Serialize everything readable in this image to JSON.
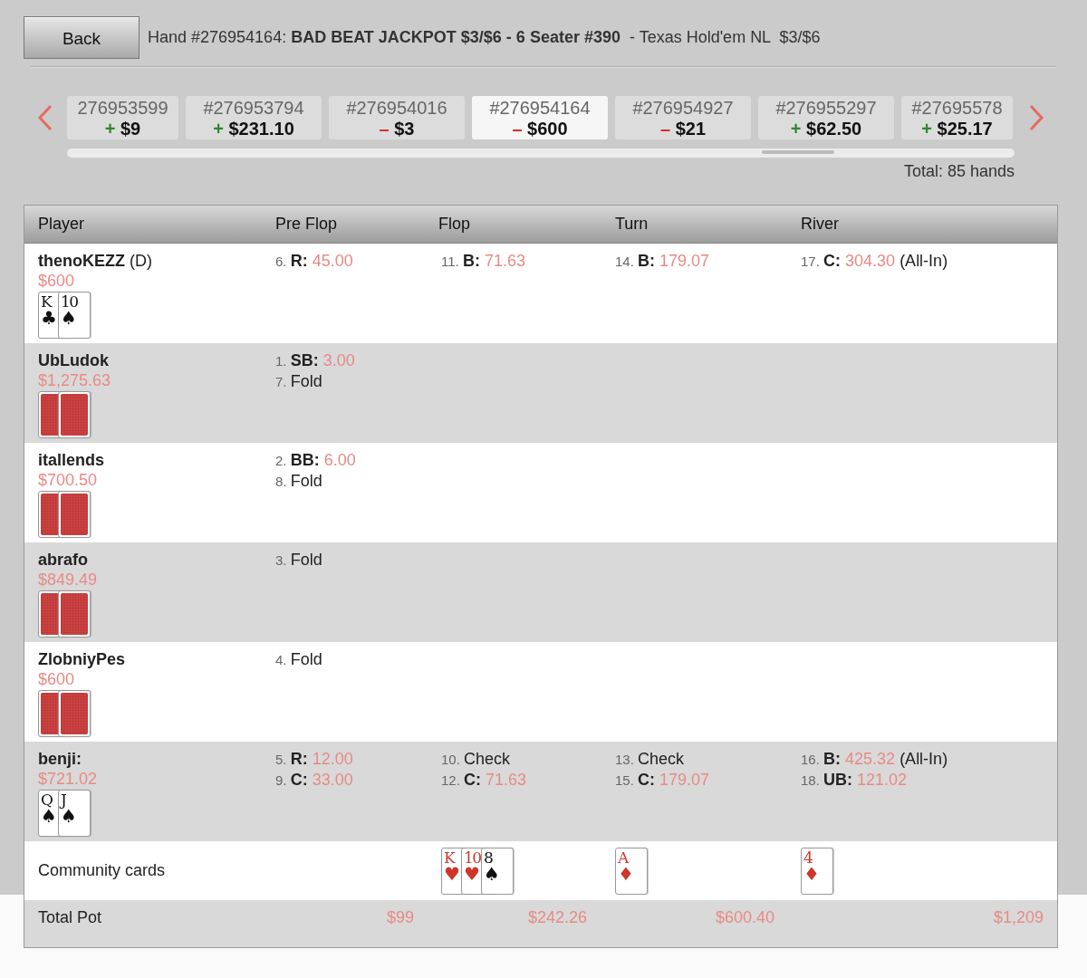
{
  "back_button": "Back",
  "title": "Hand #276954164: **BAD BEAT JACKPOT $3/$6 - 6 Seater #390**  - Texas Hold'em NL  $3/$6",
  "hands": [
    {
      "id": "276953599",
      "sign": "+",
      "amount": "$9",
      "kind": "gain",
      "selected": false
    },
    {
      "id": "#276953794",
      "sign": "+",
      "amount": "$231.10",
      "kind": "gain",
      "selected": false
    },
    {
      "id": "#276954016",
      "sign": "–",
      "amount": "$3",
      "kind": "loss",
      "selected": false
    },
    {
      "id": "#276954164",
      "sign": "–",
      "amount": "$600",
      "kind": "loss",
      "selected": true
    },
    {
      "id": "#276954927",
      "sign": "–",
      "amount": "$21",
      "kind": "loss",
      "selected": false
    },
    {
      "id": "#276955297",
      "sign": "+",
      "amount": "$62.50",
      "kind": "gain",
      "selected": false
    },
    {
      "id": "#27695578",
      "sign": "+",
      "amount": "$25.17",
      "kind": "gain",
      "selected": false
    }
  ],
  "total": "Total: 85 hands",
  "table": {
    "columns": [
      "Player",
      "Pre Flop",
      "Flop",
      "Turn",
      "River"
    ],
    "rows": [
      {
        "name": "thenoKEZZ",
        "suffix": "(D)",
        "stack": "$600",
        "cards": [
          {
            "kind": "face",
            "rank": "K",
            "suit": "♣",
            "color": "#111111"
          },
          {
            "kind": "face",
            "rank": "10",
            "suit": "♠",
            "color": "#111111"
          }
        ],
        "preflop": [
          {
            "num": "6.",
            "verb": "R:",
            "amount": "45.00"
          }
        ],
        "flop": [
          {
            "num": "11.",
            "verb": "B:",
            "amount": "71.63"
          }
        ],
        "turn": [
          {
            "num": "14.",
            "verb": "B:",
            "amount": "179.07"
          }
        ],
        "river": [
          {
            "num": "17.",
            "verb": "C:",
            "amount": "304.30",
            "note": "(All-In)"
          }
        ]
      },
      {
        "name": "UbLudok",
        "stack": "$1,275.63",
        "cards": [
          {
            "kind": "back"
          },
          {
            "kind": "back"
          }
        ],
        "preflop": [
          {
            "num": "1.",
            "verb": "SB:",
            "amount": "3.00"
          },
          {
            "num": "7.",
            "text": "Fold"
          }
        ]
      },
      {
        "name": "itallends",
        "stack": "$700.50",
        "cards": [
          {
            "kind": "back"
          },
          {
            "kind": "back"
          }
        ],
        "preflop": [
          {
            "num": "2.",
            "verb": "BB:",
            "amount": "6.00"
          },
          {
            "num": "8.",
            "text": "Fold"
          }
        ]
      },
      {
        "name": "abrafo",
        "stack": "$849.49",
        "cards": [
          {
            "kind": "back"
          },
          {
            "kind": "back"
          }
        ],
        "preflop": [
          {
            "num": "3.",
            "text": "Fold"
          }
        ]
      },
      {
        "name": "ZlobniyPes",
        "stack": "$600",
        "cards": [
          {
            "kind": "back"
          },
          {
            "kind": "back"
          }
        ],
        "preflop": [
          {
            "num": "4.",
            "text": "Fold"
          }
        ]
      },
      {
        "name": "benji:",
        "stack": "$721.02",
        "cards": [
          {
            "kind": "face",
            "rank": "Q",
            "suit": "♠",
            "color": "#111111"
          },
          {
            "kind": "face",
            "rank": "J",
            "suit": "♠",
            "color": "#111111"
          }
        ],
        "preflop": [
          {
            "num": "5.",
            "verb": "R:",
            "amount": "12.00"
          },
          {
            "num": "9.",
            "verb": "C:",
            "amount": "33.00"
          }
        ],
        "flop": [
          {
            "num": "10.",
            "text": "Check"
          },
          {
            "num": "12.",
            "verb": "C:",
            "amount": "71.63"
          }
        ],
        "turn": [
          {
            "num": "13.",
            "text": "Check"
          },
          {
            "num": "15.",
            "verb": "C:",
            "amount": "179.07"
          }
        ],
        "river": [
          {
            "num": "16.",
            "verb": "B:",
            "amount": "425.32",
            "note": "(All-In)"
          },
          {
            "num": "18.",
            "verb": "UB:",
            "amount": "121.02"
          }
        ]
      }
    ],
    "community": {
      "label": "Community cards",
      "flop": [
        {
          "kind": "face",
          "rank": "K",
          "suit": "♥",
          "color": "#d0352a"
        },
        {
          "kind": "face",
          "rank": "10",
          "suit": "♥",
          "color": "#d0352a"
        },
        {
          "kind": "face",
          "rank": "8",
          "suit": "♠",
          "color": "#111111"
        }
      ],
      "turn": [
        {
          "kind": "face",
          "rank": "A",
          "suit": "♦",
          "color": "#d0352a"
        }
      ],
      "river": [
        {
          "kind": "face",
          "rank": "4",
          "suit": "♦",
          "color": "#d0352a"
        }
      ]
    },
    "total_pot": {
      "label": "Total Pot",
      "values": [
        "$99",
        "$242.26",
        "$600.40",
        "$1,209"
      ]
    }
  }
}
